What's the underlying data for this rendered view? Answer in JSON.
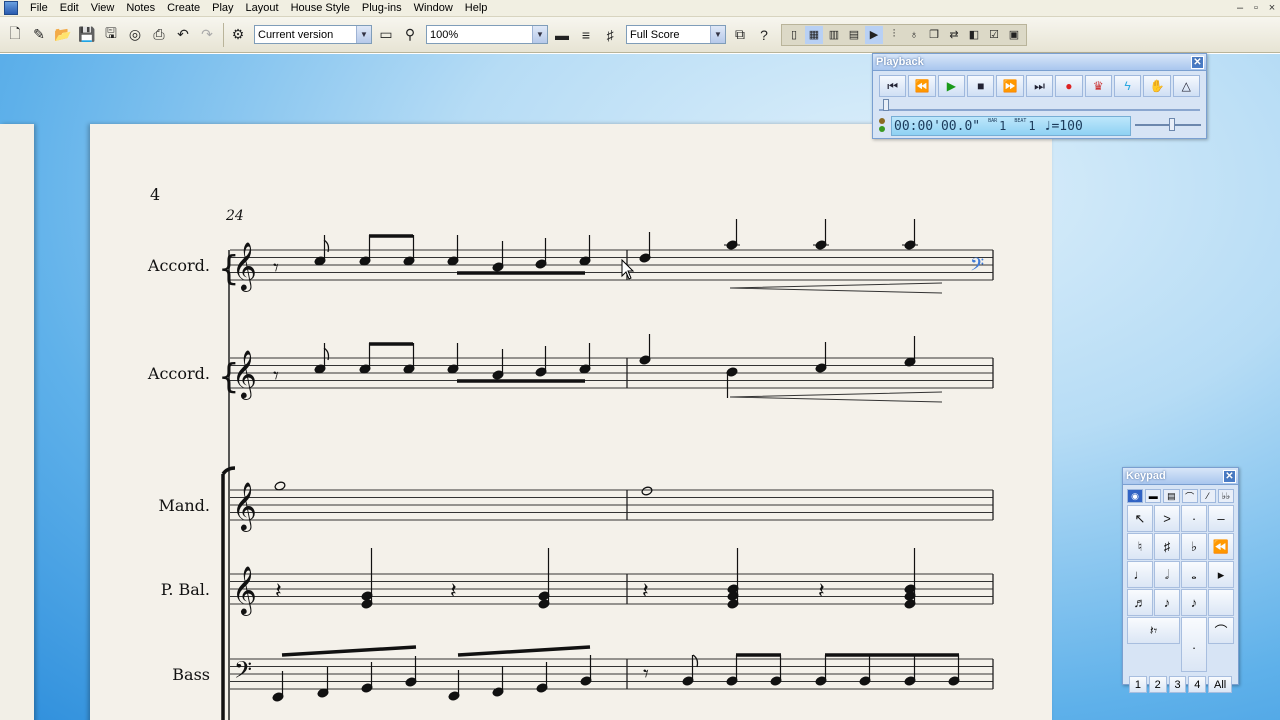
{
  "menu": [
    "File",
    "Edit",
    "View",
    "Notes",
    "Create",
    "Play",
    "Layout",
    "House Style",
    "Plug-ins",
    "Window",
    "Help"
  ],
  "window_controls": [
    "–",
    "▫",
    "×"
  ],
  "toolbar": {
    "version_select": "Current version",
    "zoom_select": "100%",
    "score_select": "Full Score",
    "help": "?"
  },
  "playback": {
    "title": "Playback",
    "time": "00:00'00.0\"",
    "bar_label": "BAR",
    "bar_value": "1",
    "beat_label": "BEAT",
    "beat_value": "1",
    "tempo": "♩=100"
  },
  "keypad": {
    "title": "Keypad",
    "tabs": [
      "◉",
      "▬",
      "▤",
      "⌒",
      "⁄",
      "♭♭"
    ],
    "keys": [
      "↖",
      ">",
      "·",
      "–",
      "♮",
      "♯",
      "♭",
      "⏪",
      "♩",
      "𝅗𝅥",
      "𝅝",
      "▸",
      "♬",
      "♪",
      "♪",
      "",
      "𝄽𝄾",
      "",
      ".",
      "⌒"
    ],
    "layouts": [
      "1",
      "2",
      "3",
      "4",
      "All"
    ]
  },
  "score": {
    "page_number": "4",
    "bar_number": "24",
    "instruments": [
      "Accord.",
      "Accord.",
      "Mand.",
      "P. Bal.",
      "Bass"
    ]
  },
  "colors": {
    "accent": "#3163c4",
    "desk": "#5fb1ea",
    "paper": "#f4f1ea"
  }
}
